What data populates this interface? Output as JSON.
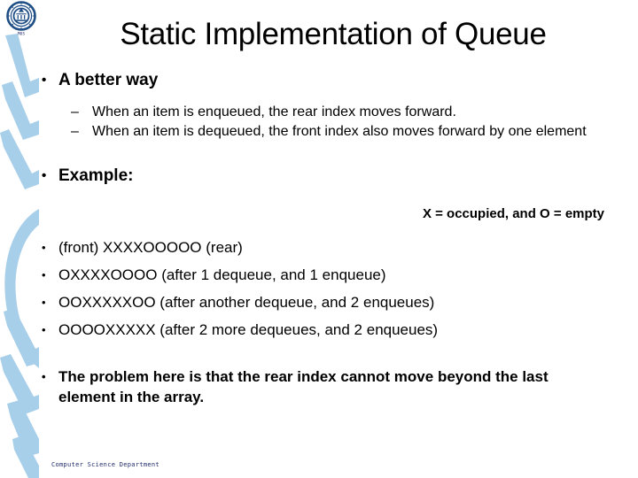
{
  "slide": {
    "title": "Static Implementation of Queue",
    "footer": "Computer Science Department",
    "logo_label": "MUS",
    "colors": {
      "band_blue": "#a8cfea",
      "seal_blue": "#1f4e87",
      "footer_navy": "#1f2a6b",
      "text_black": "#000000",
      "background": "#ffffff"
    }
  },
  "content": {
    "bullet_glyph": "•",
    "dash_glyph": "–",
    "section_better_way": {
      "heading": "A better way",
      "sub_items": [
        "When an item is enqueued, the rear index moves forward.",
        "When an item is dequeued, the front index also moves forward by one element"
      ]
    },
    "section_example": {
      "heading": "Example:",
      "legend": "X = occupied, and O = empty",
      "states": [
        "(front) XXXXOOOOO (rear)",
        "OXXXXOOOO (after 1 dequeue, and 1 enqueue)",
        "OOXXXXXOO (after another dequeue, and 2 enqueues)",
        "OOOOXXXXX (after 2 more dequeues, and 2 enqueues)"
      ]
    },
    "section_problem": {
      "text": "The problem here is that the rear index cannot move beyond the last element in the array."
    }
  }
}
